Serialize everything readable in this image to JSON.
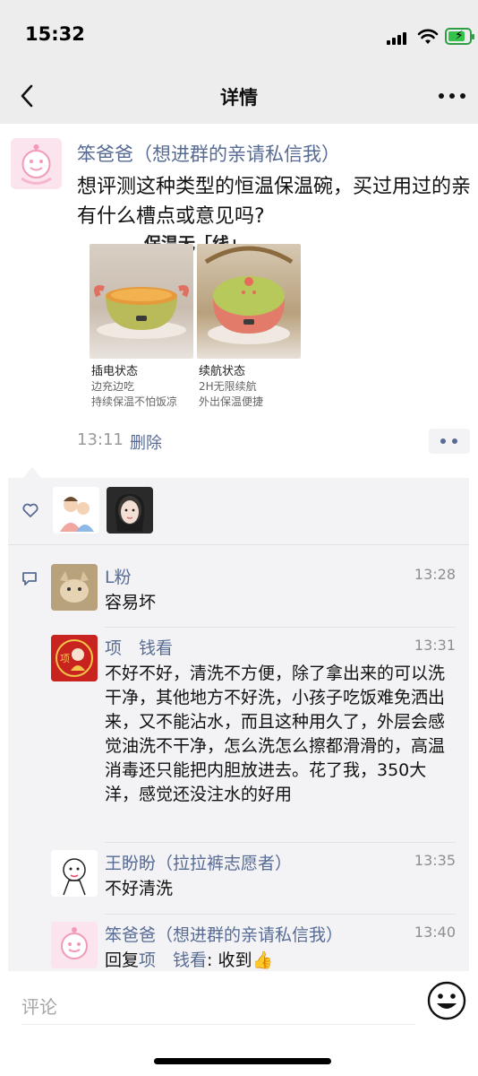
{
  "status_bar": {
    "time": "15:32"
  },
  "nav": {
    "title": "详情"
  },
  "post": {
    "author": "笨爸爸（想进群的亲请私信我）",
    "text": "想评测这种类型的恒温保温碗，买过用过的亲有什么槽点或意见吗?",
    "image": {
      "banner": "保温无「线」",
      "left_caption": {
        "title": "插电状态",
        "line1": "边充边吃",
        "line2": "持续保温不怕饭凉"
      },
      "right_caption": {
        "title": "续航状态",
        "line1": "2H无限续航",
        "line2": "外出保温便捷"
      }
    },
    "time": "13:11",
    "delete_label": "删除"
  },
  "comments": [
    {
      "name": "L粉",
      "time": "13:28",
      "text": "容易坏"
    },
    {
      "name": "项　钱看",
      "time": "13:31",
      "text": "不好不好，清洗不方便，除了拿出来的可以洗干净，其他地方不好洗，小孩子吃饭难免洒出来，又不能沾水，而且这种用久了，外层会感觉油洗不干净，怎么洗怎么擦都滑滑的，高温消毒还只能把内胆放进去。花了我，350大洋，感觉还没注水的好用"
    },
    {
      "name": "王盼盼（拉拉裤志愿者）",
      "time": "13:35",
      "text": "不好清洗"
    },
    {
      "name": "笨爸爸（想进群的亲请私信我）",
      "time": "13:40",
      "reply_prefix": "回复",
      "reply_to": "项　钱看",
      "text": ": 收到👍"
    }
  ],
  "bottom": {
    "comment_placeholder": "评论"
  },
  "colors": {
    "link": "#576b95",
    "panel_bg": "#f3f3f5",
    "bar_bg": "#ededed"
  },
  "icons": [
    "back-icon",
    "more-icon",
    "heart-icon",
    "comment-icon",
    "emoji-icon",
    "wifi-icon",
    "battery-icon"
  ]
}
